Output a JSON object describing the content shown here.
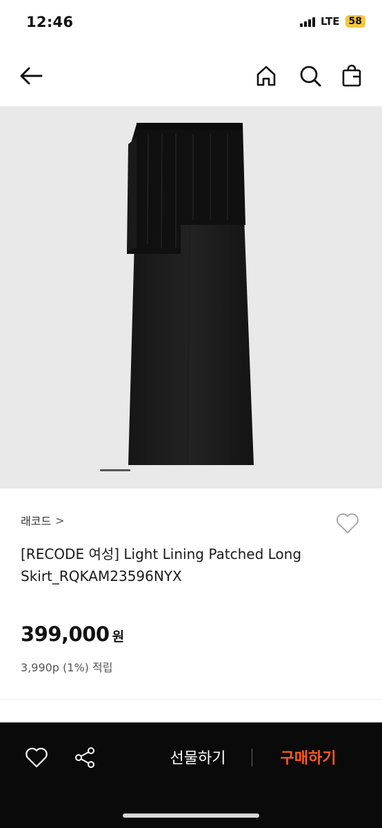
{
  "status_bar": {
    "time": "12:46",
    "network": "LTE",
    "battery": "58"
  },
  "nav": {
    "back_icon": "arrow-left-icon",
    "home_icon": "home-icon",
    "search_icon": "search-icon",
    "bag_icon": "shopping-bag-icon"
  },
  "product": {
    "image_alt_icon": "black-long-skirt-image",
    "brand": "래코드",
    "brand_chevron": ">",
    "title": "[RECODE 여성] Light Lining Patched Long Skirt_RQKAM23596NYX",
    "price": "399,000",
    "currency": "원",
    "points": "3,990p (1%) 적립"
  },
  "bottom_bar": {
    "wish_icon": "heart-icon",
    "share_icon": "share-icon",
    "gift_label": "선물하기",
    "buy_label": "구매하기"
  },
  "colors": {
    "accent": "#ff5a1f",
    "bottom_bar": "#0a0a0a",
    "image_bg": "#e9e9e9",
    "battery": "#f2c744"
  }
}
